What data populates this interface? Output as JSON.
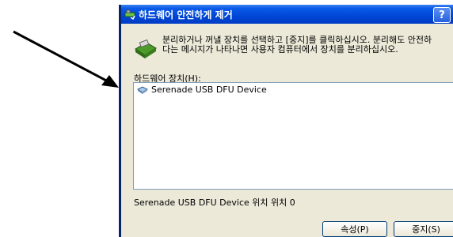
{
  "window": {
    "title": "하드웨어 안전하게 제거",
    "help_label": "?"
  },
  "instructions": {
    "line1": "분리하거나 꺼낼 장치를 선택하고 [중지]를 클릭하십시오. 분리해도 안전하",
    "line2": "다는 메시지가 나타나면 사용자 컴퓨터에서 장치를 분리하십시오."
  },
  "device_list": {
    "label": "하드웨어 장치(H):",
    "items": [
      "Serenade USB DFU Device"
    ]
  },
  "status": {
    "text": "Serenade USB DFU Device 위치 위치 0"
  },
  "buttons": {
    "properties": "속성(P)",
    "stop": "중지(S)"
  },
  "colors": {
    "titlebar": "#0046d5",
    "dialog_bg": "#ece9d8",
    "list_border": "#7f9db9"
  },
  "icons": {
    "title": "safely-remove-hardware-icon",
    "header": "hardware-device-icon",
    "list_item": "usb-device-icon",
    "pointer": "annotation-arrow"
  }
}
